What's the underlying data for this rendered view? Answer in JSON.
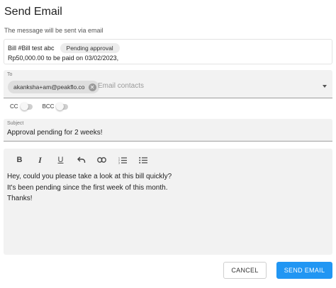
{
  "dialog": {
    "title": "Send Email",
    "subtitle": "The message will be sent via email"
  },
  "bill": {
    "name": "Bill #Bill test abc",
    "status": "Pending approval",
    "summary": "Rp50,000.00 to be paid on 03/02/2023,"
  },
  "to": {
    "label": "To",
    "chips": [
      "akanksha+am@peakflo.co"
    ],
    "placeholder": "Email contacts"
  },
  "toggles": {
    "cc_label": "CC",
    "bcc_label": "BCC",
    "cc_on": false,
    "bcc_on": false
  },
  "subject": {
    "label": "Subject",
    "value": "Approval pending for 2 weeks!"
  },
  "editor": {
    "tools": [
      "bold-icon",
      "italic-icon",
      "underline-icon",
      "undo-icon",
      "link-icon",
      "numbered-list-icon",
      "bulleted-list-icon"
    ],
    "body": [
      "Hey, could you please take a look at this bill quickly?",
      "It's been pending since the first week of this month.",
      "Thanks!"
    ]
  },
  "actions": {
    "cancel_label": "CANCEL",
    "send_label": "SEND EMAIL"
  },
  "colors": {
    "primary": "#2196f3",
    "field_background": "#f2f2f2"
  }
}
